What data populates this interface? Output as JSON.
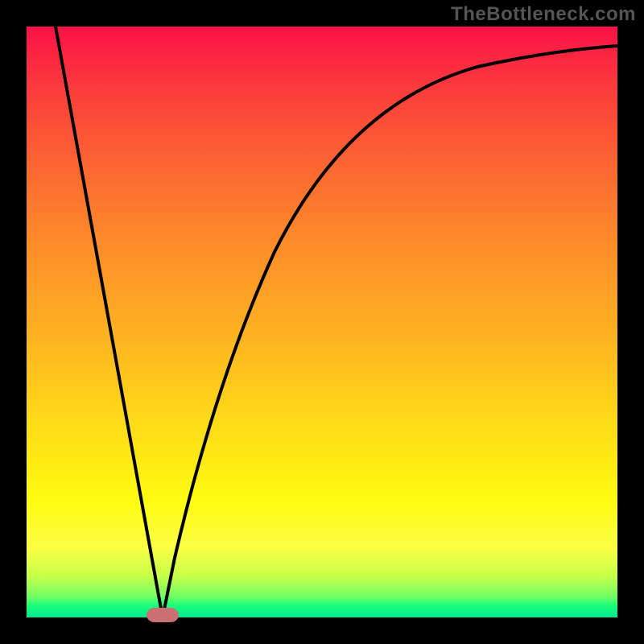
{
  "watermark": "TheBottleneck.com",
  "chart_data": {
    "type": "line",
    "title": "",
    "xlabel": "",
    "ylabel": "",
    "xlim": [
      0,
      100
    ],
    "ylim": [
      0,
      100
    ],
    "grid": false,
    "legend": false,
    "marker": {
      "x": 23,
      "y": 0,
      "color": "#cc6f73"
    },
    "series": [
      {
        "name": "left-branch",
        "x": [
          5,
          10,
          15,
          20,
          23
        ],
        "values": [
          100,
          72,
          45,
          17,
          0
        ]
      },
      {
        "name": "right-branch",
        "x": [
          23,
          25,
          28,
          32,
          38,
          45,
          55,
          65,
          75,
          85,
          95,
          100
        ],
        "values": [
          0,
          10,
          25,
          40,
          55,
          65,
          74,
          80,
          84,
          87,
          89,
          90
        ]
      }
    ],
    "gradient_stops": [
      {
        "pos": 0.0,
        "color": "#fa1246"
      },
      {
        "pos": 0.1,
        "color": "#fb3a3c"
      },
      {
        "pos": 0.22,
        "color": "#fc6133"
      },
      {
        "pos": 0.36,
        "color": "#fd8a2a"
      },
      {
        "pos": 0.52,
        "color": "#feb221"
      },
      {
        "pos": 0.66,
        "color": "#ffd819"
      },
      {
        "pos": 0.8,
        "color": "#fffb10"
      },
      {
        "pos": 0.88,
        "color": "#fcff42"
      },
      {
        "pos": 0.93,
        "color": "#c7ff4a"
      },
      {
        "pos": 0.965,
        "color": "#6fff63"
      },
      {
        "pos": 0.98,
        "color": "#1aff7c"
      },
      {
        "pos": 1.0,
        "color": "#00e98e"
      }
    ]
  }
}
